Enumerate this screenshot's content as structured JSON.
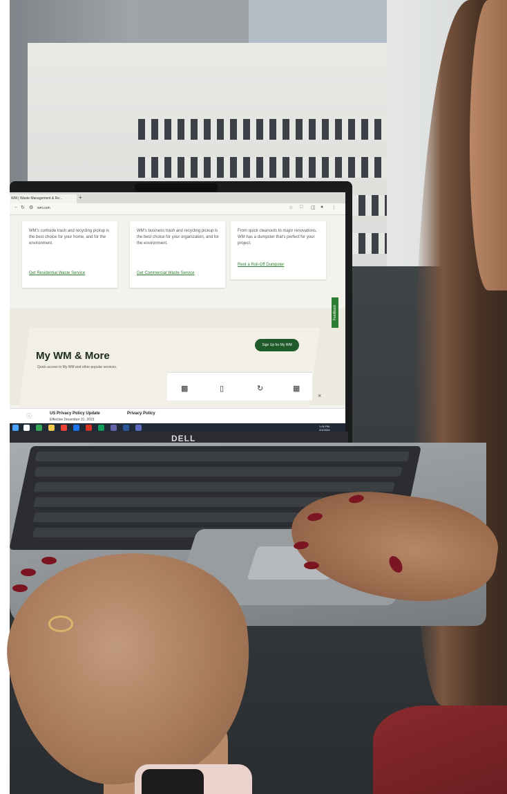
{
  "browser": {
    "tab_title": "WM | Waste Management & Re...",
    "new_tab": "+",
    "url": "wm.com",
    "nav_icons": [
      "back-icon",
      "reload-icon",
      "site-info-icon"
    ],
    "toolbar_icons": [
      "star-icon",
      "extension-icon",
      "split-icon",
      "profile-icon",
      "menu-icon"
    ]
  },
  "cards": [
    {
      "text": "WM's curbside trash and recycling pickup is the best choice for your home, and for the environment.",
      "link": "Get Residential Waste Service"
    },
    {
      "text": "WM's business trash and recycling pickup is the best choice for your organization, and for the environment.",
      "link": "Get Commercial Waste Service"
    },
    {
      "text": "From quick cleanouts to major renovations, WM has a dumpster that's perfect for your project.",
      "link": "Rent a Roll-Off Dumpster"
    }
  ],
  "hero": {
    "title": "My WM & More",
    "subtitle": "Quick access to My WM and other popular services.",
    "signup_button": "Sign Up for My WM"
  },
  "feedback_tab": "Feedback",
  "quick_icons": [
    "laptop-icon",
    "phone-icon",
    "dollar-cycle-icon",
    "calendar-icon"
  ],
  "close_icon": "×",
  "policy": {
    "title": "US Privacy Policy Update",
    "date": "Effective December 31, 2023",
    "link": "Privacy Policy"
  },
  "taskbar": {
    "time": "1:06 PM",
    "date": "2/1/2024"
  },
  "laptop_brand": "DELL",
  "colors": {
    "wm_green": "#1e5a2a",
    "feedback_green": "#2e7d32",
    "nail_polish": "#7b1521",
    "desk": "#33373a"
  }
}
